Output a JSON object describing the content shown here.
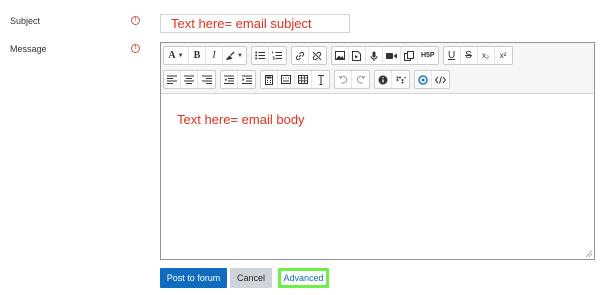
{
  "subject": {
    "label": "Subject",
    "value": "Text here= email subject",
    "required_icon": "exclamation-circle-icon"
  },
  "message": {
    "label": "Message",
    "body_text": "Text here= email body",
    "required_icon": "exclamation-circle-icon"
  },
  "toolbar": {
    "row1": [
      {
        "name": "paragraph-style-button",
        "label": "A",
        "icon": "font-style-icon"
      },
      {
        "name": "bold-button",
        "label": "B",
        "icon": "bold-icon"
      },
      {
        "name": "italic-button",
        "label": "I",
        "icon": "italic-icon"
      },
      {
        "name": "brush-button",
        "label": "",
        "icon": "brush-icon"
      },
      {
        "name": "unordered-list-button",
        "label": "",
        "icon": "unordered-list-icon"
      },
      {
        "name": "ordered-list-button",
        "label": "",
        "icon": "ordered-list-icon"
      },
      {
        "name": "link-button",
        "label": "",
        "icon": "link-icon"
      },
      {
        "name": "unlink-button",
        "label": "",
        "icon": "unlink-icon"
      },
      {
        "name": "image-button",
        "label": "",
        "icon": "image-icon"
      },
      {
        "name": "media-button",
        "label": "",
        "icon": "file-media-icon"
      },
      {
        "name": "record-audio-button",
        "label": "",
        "icon": "microphone-icon"
      },
      {
        "name": "record-video-button",
        "label": "",
        "icon": "video-camera-icon"
      },
      {
        "name": "manage-files-button",
        "label": "",
        "icon": "files-icon"
      },
      {
        "name": "h5p-button",
        "label": "H5P",
        "icon": "h5p-icon"
      },
      {
        "name": "underline-button",
        "label": "U",
        "icon": "underline-icon"
      },
      {
        "name": "strikethrough-button",
        "label": "S",
        "icon": "strikethrough-icon"
      },
      {
        "name": "subscript-button",
        "label": "x₂",
        "icon": "subscript-icon"
      },
      {
        "name": "superscript-button",
        "label": "x²",
        "icon": "superscript-icon"
      }
    ],
    "row2": [
      {
        "name": "align-left-button",
        "icon": "align-left-icon"
      },
      {
        "name": "align-center-button",
        "icon": "align-center-icon"
      },
      {
        "name": "align-right-button",
        "icon": "align-right-icon"
      },
      {
        "name": "outdent-button",
        "icon": "outdent-icon"
      },
      {
        "name": "indent-button",
        "icon": "indent-icon"
      },
      {
        "name": "equation-button",
        "icon": "calculator-icon"
      },
      {
        "name": "special-chars-button",
        "icon": "keyboard-icon"
      },
      {
        "name": "table-button",
        "icon": "table-icon"
      },
      {
        "name": "clear-formatting-button",
        "icon": "clear-format-icon"
      },
      {
        "name": "undo-button",
        "icon": "undo-icon"
      },
      {
        "name": "redo-button",
        "icon": "redo-icon"
      },
      {
        "name": "accessibility-checker-button",
        "icon": "info-circle-icon"
      },
      {
        "name": "screenreader-helper-button",
        "icon": "braille-icon"
      },
      {
        "name": "emoji-button",
        "icon": "circle-icon"
      },
      {
        "name": "html-button",
        "icon": "code-icon"
      }
    ]
  },
  "buttons": {
    "post": "Post to forum",
    "cancel": "Cancel",
    "advanced": "Advanced"
  },
  "colors": {
    "primary": "#0f6cbf",
    "annotation_text": "#e8301e",
    "highlight_box": "#6cf048",
    "required": "#d9534f"
  }
}
